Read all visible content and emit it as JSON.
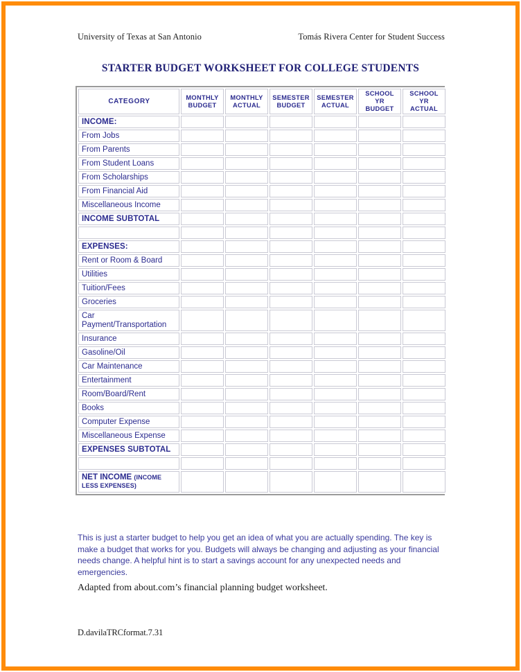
{
  "document": {
    "org_left": "University of Texas at San Antonio",
    "org_right": "Tomás Rivera Center for Student Success",
    "title": "STARTER BUDGET WORKSHEET FOR COLLEGE STUDENTS",
    "note": "This is just a starter budget to help you get an idea of what you are actually spending. The key is make a budget that works for you. Budgets will always be changing and adjusting as your financial needs change. A helpful hint is to start a savings account for any unexpected needs and emergencies.",
    "adapted": "Adapted from about.com’s financial planning budget worksheet.",
    "doc_code": "D.davilaTRCformat.7.31"
  },
  "colors": {
    "frame": "#FF8C0A",
    "heading_blue": "#232377",
    "table_text_blue": "#2b2b8f",
    "note_blue": "#3a3a9c",
    "cell_border": "#c9c9d4",
    "table_outer_border": "#9a9a9a"
  },
  "table": {
    "columns": [
      "CATEGORY",
      "MONTHLY BUDGET",
      "MONTHLY ACTUAL",
      "SEMESTER BUDGET",
      "SEMESTER ACTUAL",
      "SCHOOL YR BUDGET",
      "SCHOOL YR ACTUAL"
    ],
    "columns_wrapped": [
      [
        "CATEGORY"
      ],
      [
        "MONTHLY",
        "BUDGET"
      ],
      [
        "MONTHLY",
        "ACTUAL"
      ],
      [
        "SEMESTER",
        "BUDGET"
      ],
      [
        "SEMESTER",
        "ACTUAL"
      ],
      [
        "SCHOOL YR",
        "BUDGET"
      ],
      [
        "SCHOOL YR",
        "ACTUAL"
      ]
    ],
    "rows": [
      {
        "label": "INCOME:",
        "style": "bold",
        "values": [
          "",
          "",
          "",
          "",
          "",
          ""
        ]
      },
      {
        "label": "From Jobs",
        "style": "normal",
        "values": [
          "",
          "",
          "",
          "",
          "",
          ""
        ]
      },
      {
        "label": "From Parents",
        "style": "normal",
        "values": [
          "",
          "",
          "",
          "",
          "",
          ""
        ]
      },
      {
        "label": "From Student Loans",
        "style": "normal",
        "values": [
          "",
          "",
          "",
          "",
          "",
          ""
        ]
      },
      {
        "label": "From Scholarships",
        "style": "normal",
        "values": [
          "",
          "",
          "",
          "",
          "",
          ""
        ]
      },
      {
        "label": "From Financial Aid",
        "style": "normal",
        "values": [
          "",
          "",
          "",
          "",
          "",
          ""
        ]
      },
      {
        "label": "Miscellaneous Income",
        "style": "normal",
        "values": [
          "",
          "",
          "",
          "",
          "",
          ""
        ]
      },
      {
        "label": "INCOME SUBTOTAL",
        "style": "bold",
        "values": [
          "",
          "",
          "",
          "",
          "",
          ""
        ]
      },
      {
        "label": "",
        "style": "blank",
        "values": [
          "",
          "",
          "",
          "",
          "",
          ""
        ]
      },
      {
        "label": "EXPENSES:",
        "style": "bold",
        "values": [
          "",
          "",
          "",
          "",
          "",
          ""
        ]
      },
      {
        "label": "Rent or Room & Board",
        "style": "normal",
        "values": [
          "",
          "",
          "",
          "",
          "",
          ""
        ]
      },
      {
        "label": "Utilities",
        "style": "normal",
        "values": [
          "",
          "",
          "",
          "",
          "",
          ""
        ]
      },
      {
        "label": "Tuition/Fees",
        "style": "normal",
        "values": [
          "",
          "",
          "",
          "",
          "",
          ""
        ]
      },
      {
        "label": "Groceries",
        "style": "normal",
        "values": [
          "",
          "",
          "",
          "",
          "",
          ""
        ]
      },
      {
        "label": "Car Payment/Transportation",
        "style": "tall",
        "values": [
          "",
          "",
          "",
          "",
          "",
          ""
        ]
      },
      {
        "label": "Insurance",
        "style": "normal",
        "values": [
          "",
          "",
          "",
          "",
          "",
          ""
        ]
      },
      {
        "label": "Gasoline/Oil",
        "style": "normal",
        "values": [
          "",
          "",
          "",
          "",
          "",
          ""
        ]
      },
      {
        "label": "Car Maintenance",
        "style": "normal",
        "values": [
          "",
          "",
          "",
          "",
          "",
          ""
        ]
      },
      {
        "label": "Entertainment",
        "style": "normal",
        "values": [
          "",
          "",
          "",
          "",
          "",
          ""
        ]
      },
      {
        "label": "Room/Board/Rent",
        "style": "normal",
        "values": [
          "",
          "",
          "",
          "",
          "",
          ""
        ]
      },
      {
        "label": "Books",
        "style": "normal",
        "values": [
          "",
          "",
          "",
          "",
          "",
          ""
        ]
      },
      {
        "label": "Computer Expense",
        "style": "normal",
        "values": [
          "",
          "",
          "",
          "",
          "",
          ""
        ]
      },
      {
        "label": "Miscellaneous Expense",
        "style": "normal",
        "values": [
          "",
          "",
          "",
          "",
          "",
          ""
        ]
      },
      {
        "label": "EXPENSES SUBTOTAL",
        "style": "bold",
        "values": [
          "",
          "",
          "",
          "",
          "",
          ""
        ]
      },
      {
        "label": "",
        "style": "blank",
        "values": [
          "",
          "",
          "",
          "",
          "",
          ""
        ]
      },
      {
        "label_main": "NET INCOME",
        "label_small": "(INCOME LESS EXPENSES)",
        "style": "net",
        "values": [
          "",
          "",
          "",
          "",
          "",
          ""
        ]
      }
    ]
  }
}
